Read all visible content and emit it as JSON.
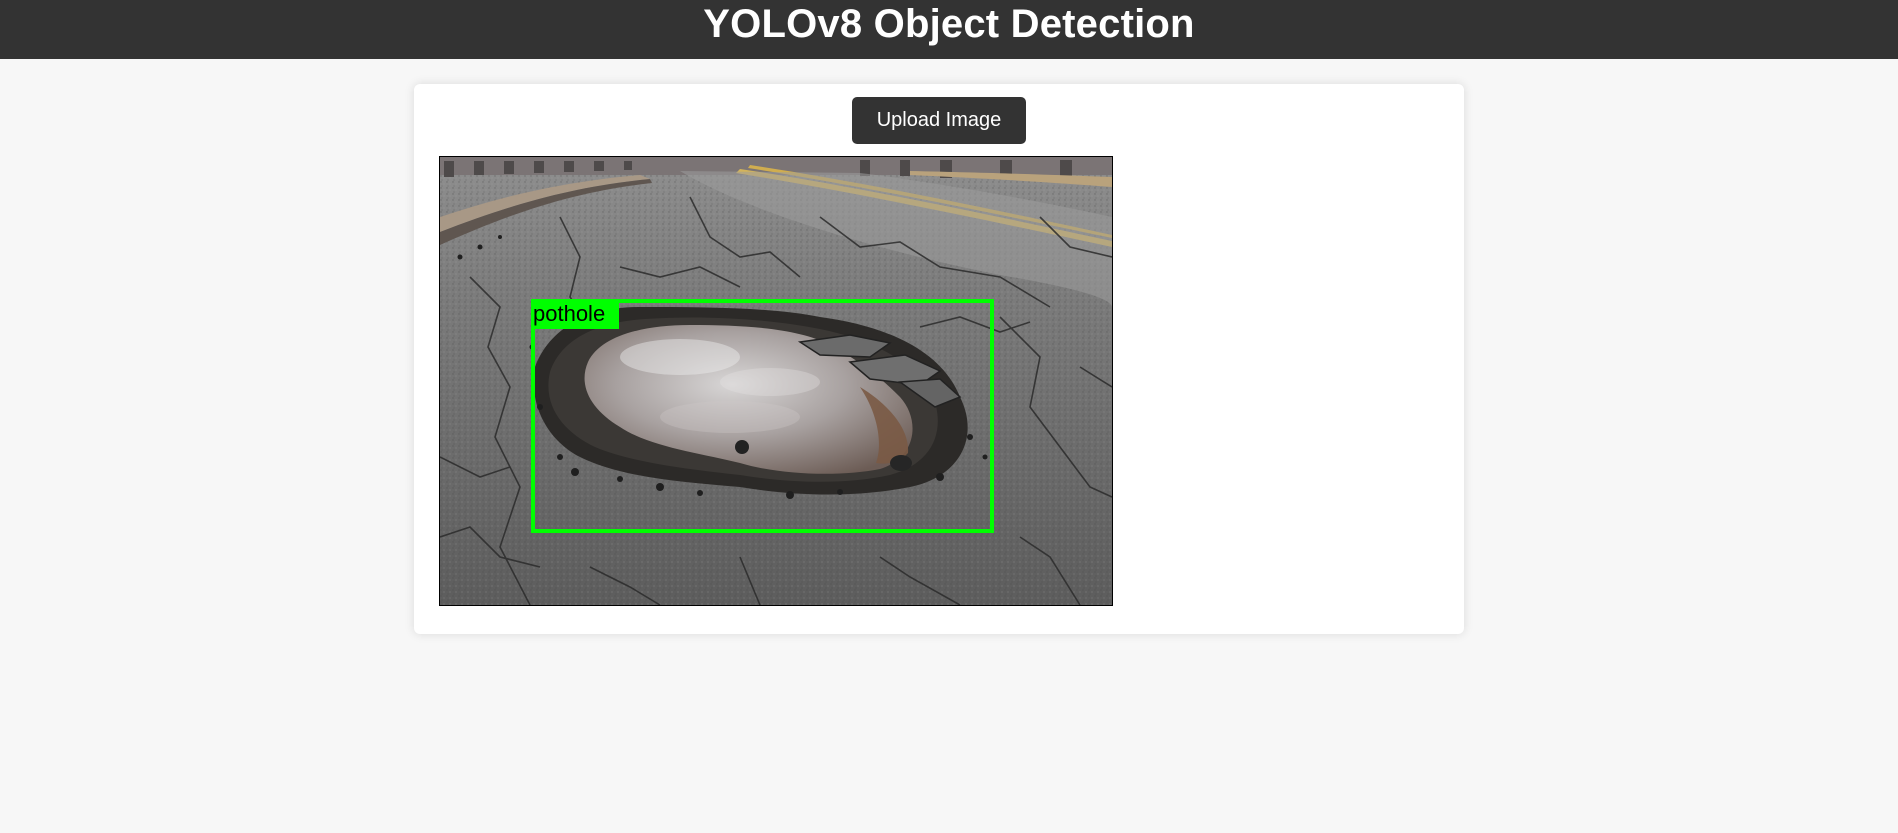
{
  "header": {
    "title": "YOLOv8 Object Detection"
  },
  "toolbar": {
    "upload_label": "Upload Image"
  },
  "detections": [
    {
      "label": "pothole",
      "color": "#00ff00"
    }
  ],
  "colors": {
    "header_bg": "#333333",
    "page_bg": "#f7f7f7",
    "button_bg": "#333333",
    "box_color": "#00ff00"
  }
}
